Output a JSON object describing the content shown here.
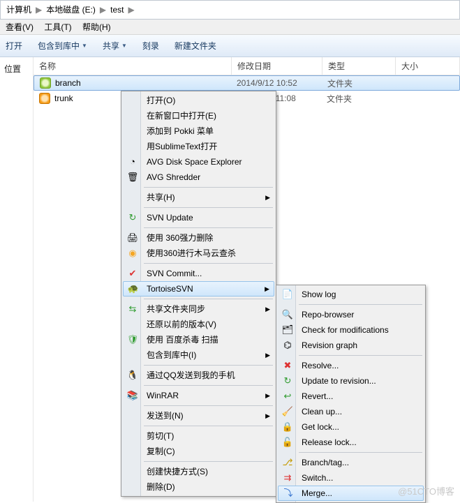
{
  "breadcrumb": {
    "p0": "计算机",
    "p1": "本地磁盘 (E:)",
    "p2": "test",
    "sep": "▶"
  },
  "menubar": {
    "view": "查看(V)",
    "tools": "工具(T)",
    "help": "帮助(H)"
  },
  "toolbar": {
    "open": "打开",
    "include": "包含到库中",
    "share": "共享",
    "burn": "刻录",
    "newfolder": "新建文件夹"
  },
  "cols": {
    "name": "名称",
    "date": "修改日期",
    "type": "类型",
    "size": "大小"
  },
  "rows": [
    {
      "name": "branch",
      "date": "2014/9/12 10:52",
      "type": "文件夹"
    },
    {
      "name": "trunk",
      "date": "2014/9/12 11:08",
      "type": "文件夹"
    }
  ],
  "leftnav": {
    "pos": "位置"
  },
  "menu1": [
    {
      "t": "打开(O)"
    },
    {
      "t": "在新窗口中打开(E)"
    },
    {
      "t": "添加到 Pokki 菜单"
    },
    {
      "t": "用SublimeText打开"
    },
    {
      "t": "AVG Disk Space Explorer",
      "i": "◔"
    },
    {
      "t": "AVG Shredder",
      "i": "🗑"
    },
    {
      "sep": true
    },
    {
      "t": "共享(H)",
      "sub": true
    },
    {
      "sep": true
    },
    {
      "t": "SVN Update",
      "i": "↻",
      "ic": "#2e9b2e"
    },
    {
      "sep": true
    },
    {
      "t": "使用 360强力删除",
      "i": "🖨"
    },
    {
      "t": "使用360进行木马云查杀",
      "i": "◉",
      "ic": "#f5a623"
    },
    {
      "sep": true
    },
    {
      "t": "SVN Commit...",
      "i": "✔",
      "ic": "#d33"
    },
    {
      "t": "TortoiseSVN",
      "i": "🐢",
      "sub": true,
      "hl": true
    },
    {
      "sep": true
    },
    {
      "t": "共享文件夹同步",
      "i": "⇆",
      "ic": "#2e9b2e",
      "sub": true
    },
    {
      "t": "还原以前的版本(V)"
    },
    {
      "t": "使用 百度杀毒 扫描",
      "i": "🛡",
      "ic": "#2e9b2e"
    },
    {
      "t": "包含到库中(I)",
      "sub": true
    },
    {
      "sep": true
    },
    {
      "t": "通过QQ发送到我的手机",
      "i": "🐧"
    },
    {
      "sep": true
    },
    {
      "t": "WinRAR",
      "i": "📚",
      "sub": true
    },
    {
      "sep": true
    },
    {
      "t": "发送到(N)",
      "sub": true
    },
    {
      "sep": true
    },
    {
      "t": "剪切(T)"
    },
    {
      "t": "复制(C)"
    },
    {
      "sep": true
    },
    {
      "t": "创建快捷方式(S)"
    },
    {
      "t": "删除(D)"
    }
  ],
  "menu2": [
    {
      "t": "Show log",
      "i": "📄"
    },
    {
      "sep": true
    },
    {
      "t": "Repo-browser",
      "i": "🔍"
    },
    {
      "t": "Check for modifications",
      "i": "🗂"
    },
    {
      "t": "Revision graph",
      "i": "⌬"
    },
    {
      "sep": true
    },
    {
      "t": "Resolve...",
      "i": "✖",
      "ic": "#d33"
    },
    {
      "t": "Update to revision...",
      "i": "↻",
      "ic": "#2e9b2e"
    },
    {
      "t": "Revert...",
      "i": "↩",
      "ic": "#2e9b2e"
    },
    {
      "t": "Clean up...",
      "i": "🧹"
    },
    {
      "t": "Get lock...",
      "i": "🔒",
      "ic": "#c49a00"
    },
    {
      "t": "Release lock...",
      "i": "🔓",
      "ic": "#c49a00"
    },
    {
      "sep": true
    },
    {
      "t": "Branch/tag...",
      "i": "⎇",
      "ic": "#c49a00"
    },
    {
      "t": "Switch...",
      "i": "⇉",
      "ic": "#d33"
    },
    {
      "t": "Merge...",
      "i": "⤵",
      "ic": "#2a6bcc",
      "hl": true
    }
  ],
  "watermark": "@51CTO博客"
}
